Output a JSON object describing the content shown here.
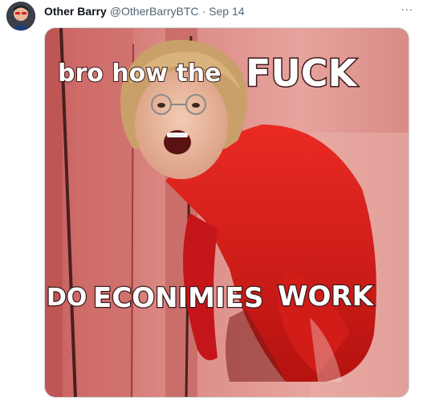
{
  "tweet": {
    "display_name": "Other Barry",
    "handle": "@OtherBarryBTC",
    "separator": "·",
    "timestamp": "Sep 14",
    "more_icon": "···"
  },
  "media": {
    "caption_top_small": "bro how the ",
    "caption_top_big": "FUCK",
    "caption_bottom_1": "DO",
    "caption_bottom_2": "ECONIMIES",
    "caption_bottom_3": "WORK"
  },
  "colors": {
    "name": "#0f1419",
    "muted": "#536471",
    "border": "#cfd9de",
    "meme_background": "#d67b78",
    "shirt": "#e01b1b"
  },
  "icons": {
    "avatar": "avatar",
    "more": "more-horizontal-icon"
  }
}
